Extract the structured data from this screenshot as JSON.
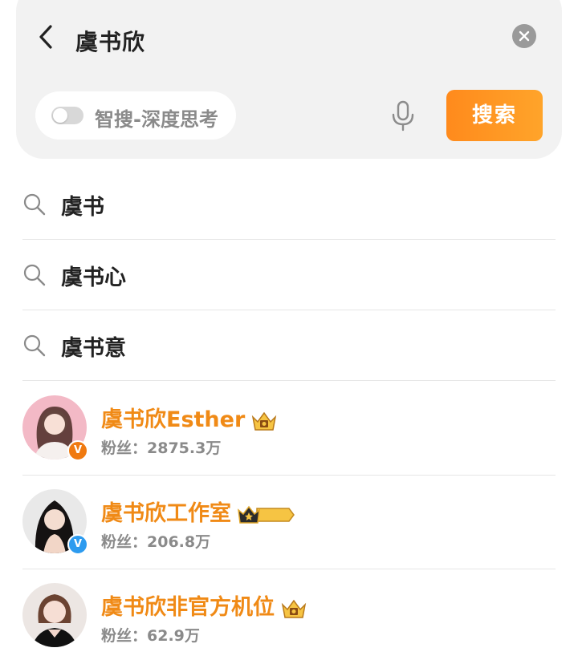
{
  "search": {
    "query": "虞书欣",
    "deep_search_label": "智搜-深度思考",
    "deep_search_enabled": false,
    "button_label": "搜索"
  },
  "suggestions": [
    {
      "text": "虞书"
    },
    {
      "text": "虞书心"
    },
    {
      "text": "虞书意"
    }
  ],
  "users": [
    {
      "name": "虞书欣Esther",
      "fans": "粉丝：2875.3万",
      "verified_color": "#f07a10",
      "avatar_bg": "#f4b7c4",
      "crown": "gold"
    },
    {
      "name": "虞书欣工作室",
      "fans": "粉丝：206.8万",
      "verified_color": "#2d9bef",
      "avatar_bg": "#1e1a1a",
      "crown": "black-gold-I",
      "crown_level": "I"
    },
    {
      "name": "虞书欣非官方机位",
      "fans": "粉丝：62.9万",
      "verified_color": "",
      "avatar_bg": "#e9d4cf",
      "crown": "gold"
    }
  ],
  "colors": {
    "accent_orange": "#ff9a22",
    "username_orange": "#f08a16",
    "verified_orange": "#f07a10",
    "verified_blue": "#2d9bef"
  }
}
